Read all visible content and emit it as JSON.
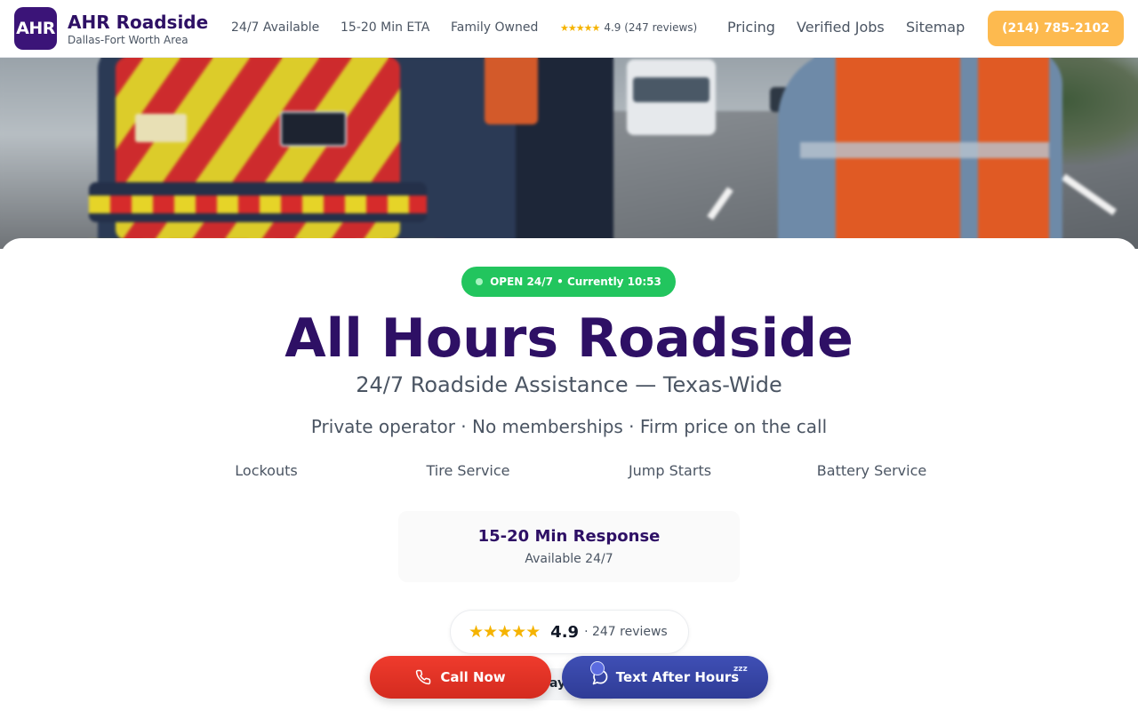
{
  "brand": {
    "logo_text": "AHR",
    "name": "AHR Roadside",
    "area": "Dallas-Fort Worth Area"
  },
  "header": {
    "badges": [
      "24/7 Available",
      "15-20 Min ETA",
      "Family Owned"
    ],
    "rating_stars": "★★★★★",
    "rating_text": "4.9 (247 reviews)",
    "nav": [
      "Pricing",
      "Verified Jobs",
      "Sitemap"
    ],
    "phone": "(214) 785-2102"
  },
  "hero": {
    "status": "OPEN 24/7 • Currently 10:53",
    "title": "All Hours Roadside",
    "subtitle": "24/7 Roadside Assistance — Texas-Wide",
    "tagline": "Private operator · No memberships · Firm price on the call"
  },
  "services": [
    "Lockouts",
    "Tire Service",
    "Jump Starts",
    "Battery Service"
  ],
  "response": {
    "title": "15-20 Min Response",
    "sub": "Available 24/7"
  },
  "rating": {
    "stars": "★★★★★",
    "score": "4.9",
    "count": "· 247 reviews"
  },
  "partial_pill_text": "ay",
  "cta": {
    "call": "Call Now",
    "text": "Text After Hours",
    "zzz": "zzz"
  },
  "colors": {
    "brand_purple": "#2e1065",
    "logo_bg": "#3b1478",
    "open_green": "#22c55e",
    "phone_orange": "#fdba4f",
    "call_red": "#e2322a",
    "text_blue": "#3746a8",
    "star_gold": "#f5b301"
  }
}
